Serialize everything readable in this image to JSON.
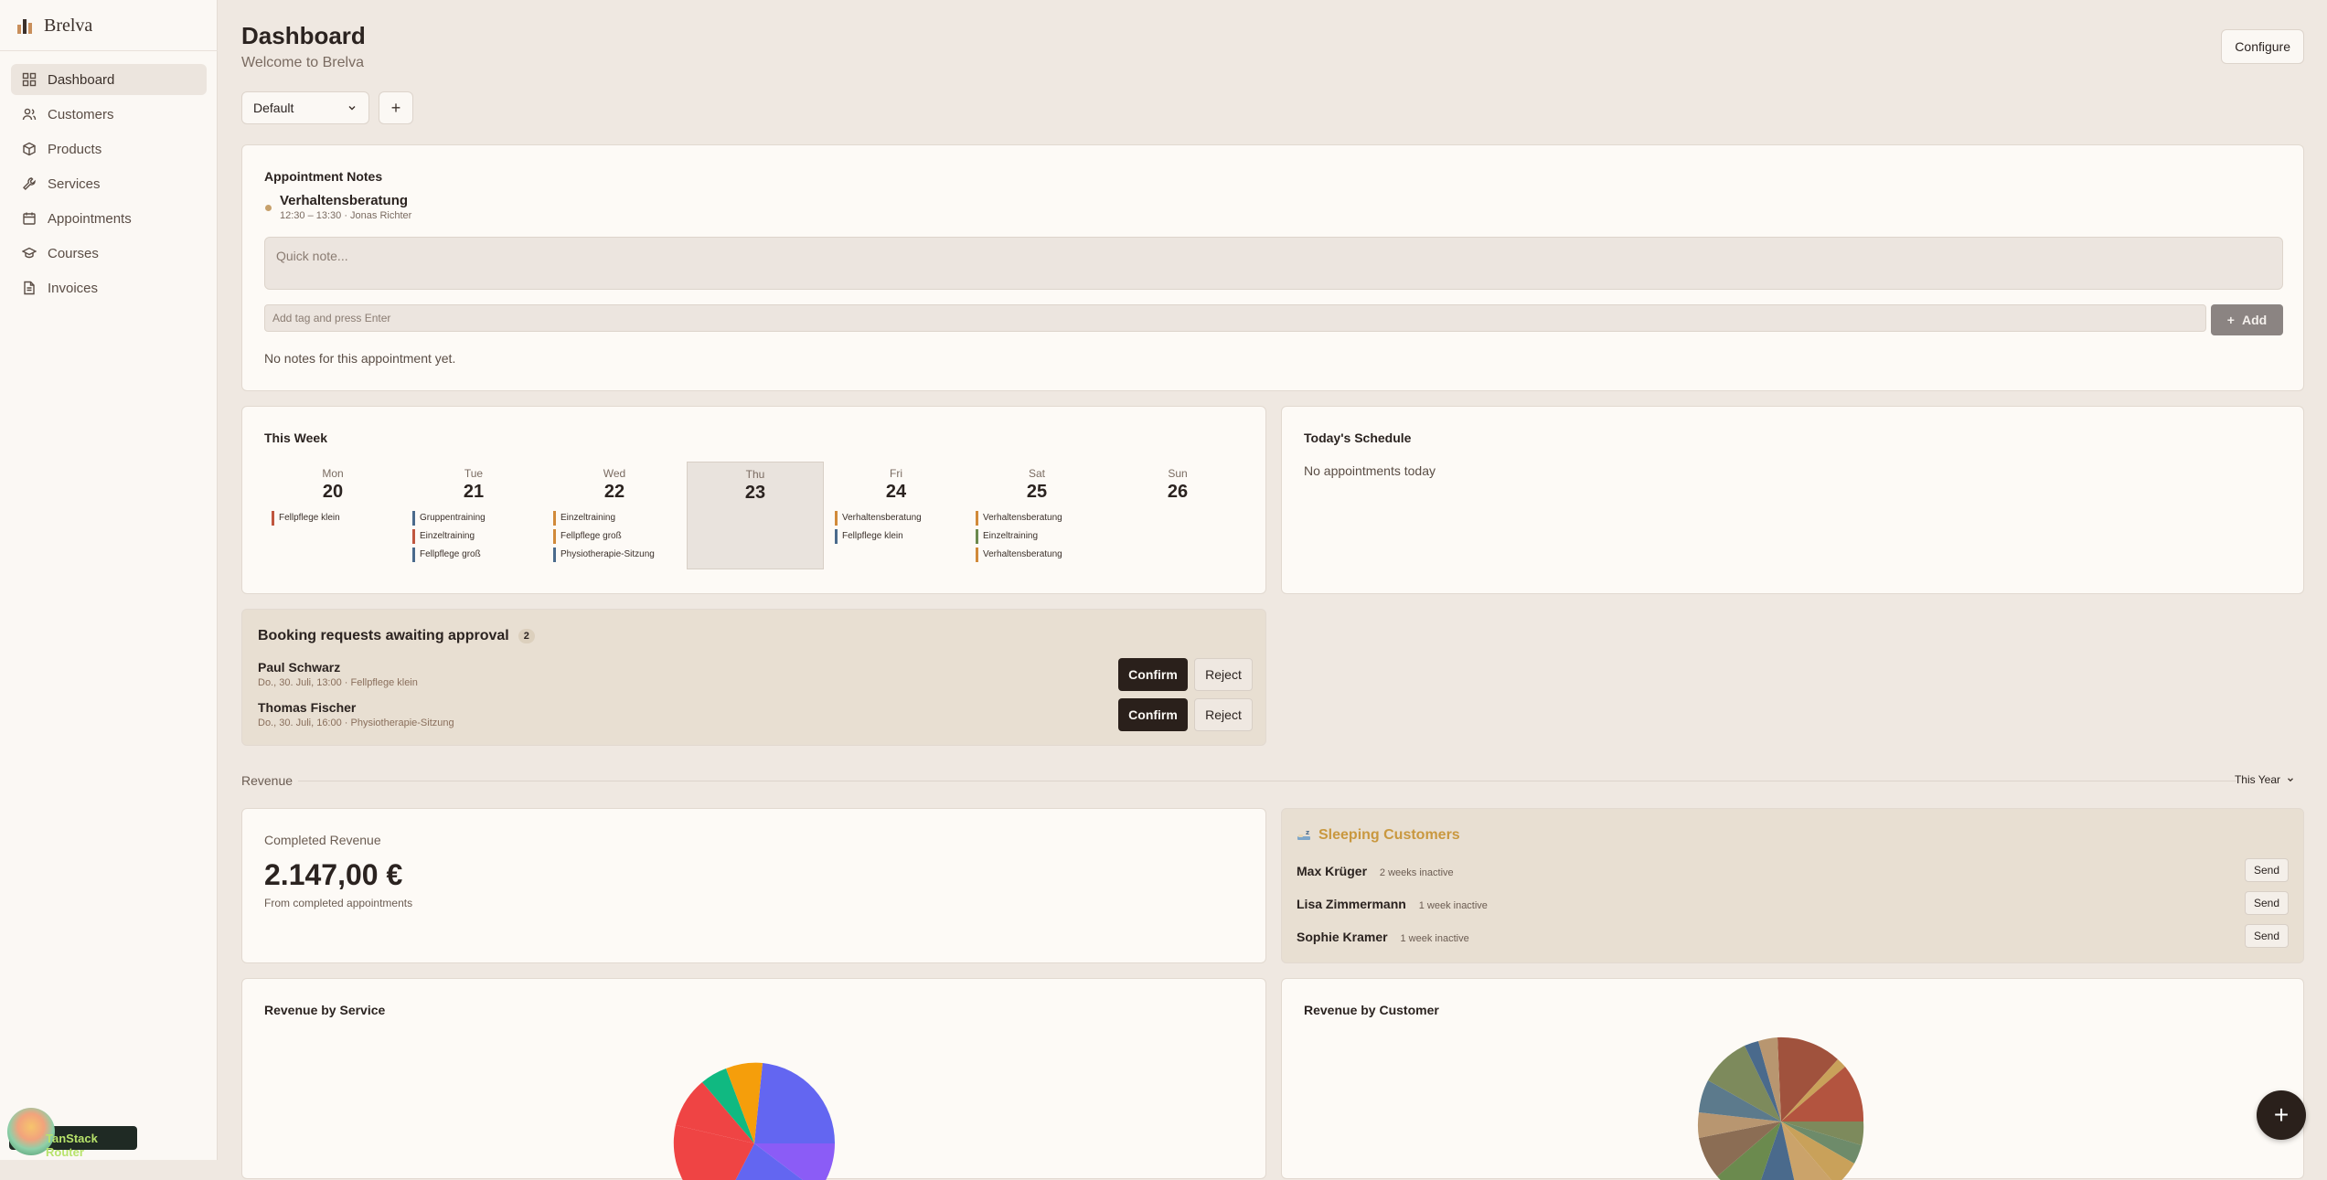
{
  "app": {
    "name": "Brelva"
  },
  "sidebar": {
    "items": [
      {
        "label": "Dashboard",
        "icon": "dashboard-icon",
        "active": true
      },
      {
        "label": "Customers",
        "icon": "users-icon"
      },
      {
        "label": "Products",
        "icon": "package-icon"
      },
      {
        "label": "Services",
        "icon": "wrench-icon"
      },
      {
        "label": "Appointments",
        "icon": "calendar-icon"
      },
      {
        "label": "Courses",
        "icon": "graduation-cap-icon"
      },
      {
        "label": "Invoices",
        "icon": "file-text-icon"
      }
    ]
  },
  "router_badge": {
    "label": "TanStack Router"
  },
  "header": {
    "title": "Dashboard",
    "subtitle": "Welcome to Brelva",
    "configure_label": "Configure",
    "layout_value": "Default",
    "add_label": "+"
  },
  "notes": {
    "title": "Appointment Notes",
    "appointment_name": "Verhaltensberatung",
    "appointment_meta": "12:30 – 13:30 · Jonas Richter",
    "quick_note_placeholder": "Quick note...",
    "tag_placeholder": "Add tag and press Enter",
    "add_label": "Add",
    "empty_text": "No notes for this appointment yet."
  },
  "week": {
    "title": "This Week",
    "days": [
      {
        "name": "Mon",
        "num": "20",
        "appts": [
          {
            "label": "Fellpflege klein",
            "color": "#c0563f"
          }
        ]
      },
      {
        "name": "Tue",
        "num": "21",
        "appts": [
          {
            "label": "Gruppentraining",
            "color": "#4a6a8c"
          },
          {
            "label": "Einzeltraining",
            "color": "#c0563f"
          },
          {
            "label": "Fellpflege groß",
            "color": "#4a6a8c"
          }
        ]
      },
      {
        "name": "Wed",
        "num": "22",
        "appts": [
          {
            "label": "Einzeltraining",
            "color": "#d18a3a"
          },
          {
            "label": "Fellpflege groß",
            "color": "#d18a3a"
          },
          {
            "label": "Physiotherapie-Sitzung",
            "color": "#4a6a8c"
          }
        ]
      },
      {
        "name": "Thu",
        "num": "23",
        "today": true,
        "appts": []
      },
      {
        "name": "Fri",
        "num": "24",
        "appts": [
          {
            "label": "Verhaltensberatung",
            "color": "#d18a3a"
          },
          {
            "label": "Fellpflege klein",
            "color": "#4a6a8c"
          }
        ]
      },
      {
        "name": "Sat",
        "num": "25",
        "appts": [
          {
            "label": "Verhaltensberatung",
            "color": "#d18a3a"
          },
          {
            "label": "Einzeltraining",
            "color": "#6b8a4e"
          },
          {
            "label": "Verhaltensberatung",
            "color": "#d18a3a"
          }
        ]
      },
      {
        "name": "Sun",
        "num": "26",
        "appts": []
      }
    ]
  },
  "schedule": {
    "title": "Today's Schedule",
    "empty_text": "No appointments today"
  },
  "booking": {
    "title": "Booking requests awaiting approval",
    "count": "2",
    "confirm_label": "Confirm",
    "reject_label": "Reject",
    "requests": [
      {
        "name": "Paul Schwarz",
        "meta": "Do., 30. Juli, 13:00 · Fellpflege klein"
      },
      {
        "name": "Thomas Fischer",
        "meta": "Do., 30. Juli, 16:00 · Physiotherapie-Sitzung"
      }
    ]
  },
  "revenue": {
    "section_label": "Revenue",
    "period": "This Year",
    "completed_label": "Completed Revenue",
    "completed_value": "2.147,00 €",
    "completed_sub": "From completed appointments"
  },
  "sleeping": {
    "title": "Sleeping Customers",
    "send_label": "Send",
    "customers": [
      {
        "name": "Max Krüger",
        "meta": "2 weeks inactive"
      },
      {
        "name": "Lisa Zimmermann",
        "meta": "1 week inactive"
      },
      {
        "name": "Sophie Kramer",
        "meta": "1 week inactive"
      }
    ]
  },
  "revenue_by_service": {
    "title": "Revenue by Service",
    "slice_colors": [
      "#6366f1",
      "#8b5cf6",
      "#ec4899",
      "#ef4444",
      "#10b981",
      "#f59e0b"
    ]
  },
  "revenue_by_customer": {
    "title": "Revenue by Customer",
    "slice_colors": [
      "#a0523d",
      "#c9a15a",
      "#7d8a5c",
      "#4a6a8c",
      "#6b8a4e",
      "#8b6d54",
      "#b89670",
      "#5c7a8c",
      "#cba36a",
      "#6e8b6a",
      "#9a7a63",
      "#b3543f"
    ]
  },
  "fab": {
    "label": "+"
  }
}
